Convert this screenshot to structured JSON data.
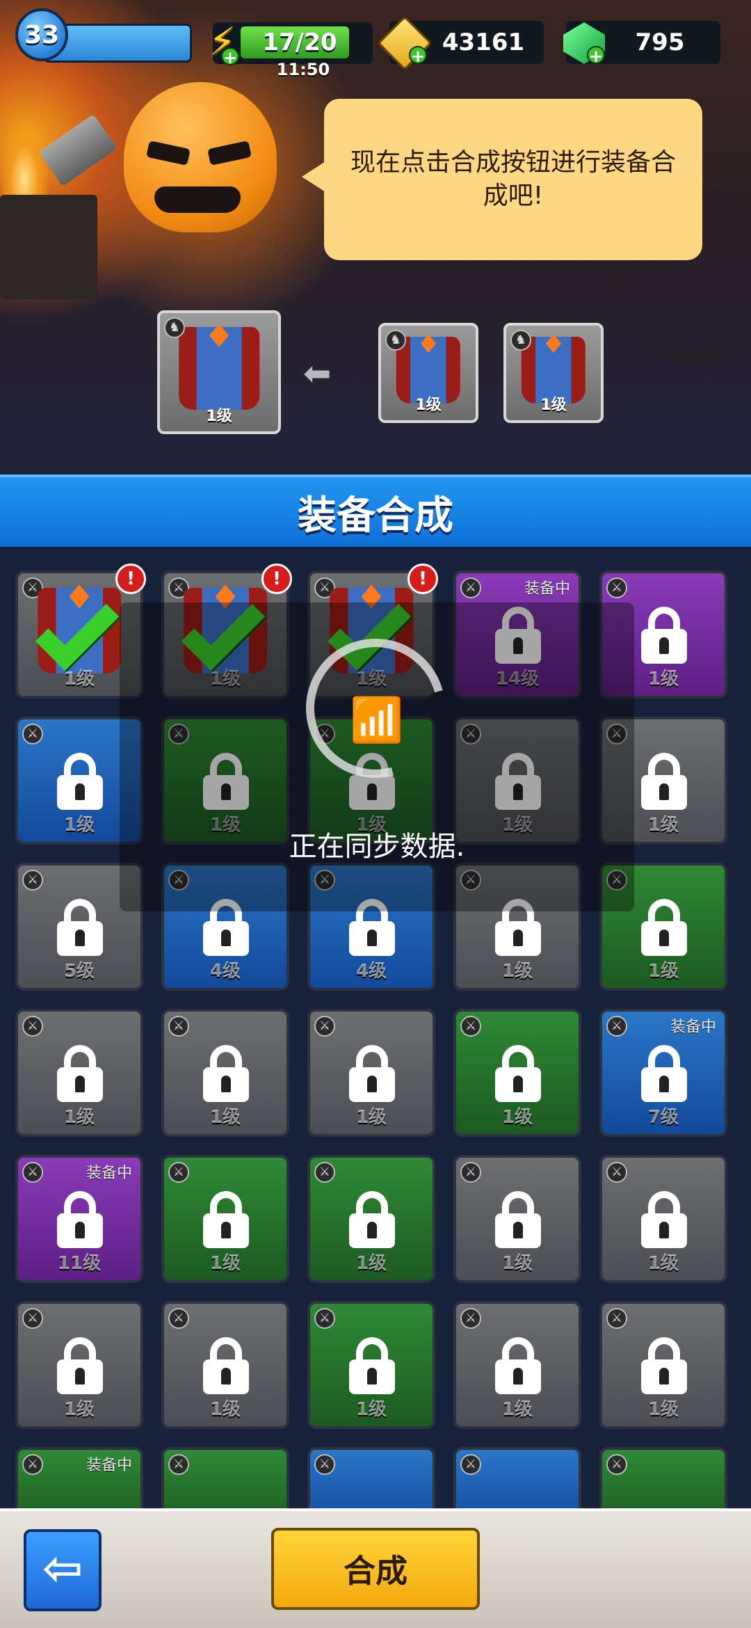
{
  "hud": {
    "player_level": "33",
    "energy": "17/20",
    "energy_timer": "11:50",
    "gold": "43161",
    "gems": "795"
  },
  "npc": {
    "speech": "现在点击合成按钮进行装备合成吧!"
  },
  "recipe": {
    "result": {
      "label": "1级"
    },
    "ingredients": [
      {
        "label": "1级"
      },
      {
        "label": "1级"
      }
    ]
  },
  "title": "装备合成",
  "sync_overlay": {
    "text": "正在同步数据."
  },
  "equip_tag": "装备中",
  "grid": [
    [
      {
        "tier": "gray",
        "label": "1级",
        "check": true,
        "alert": true
      },
      {
        "tier": "gray",
        "label": "1级",
        "check": true,
        "alert": true
      },
      {
        "tier": "gray",
        "label": "1级",
        "check": true,
        "alert": true
      },
      {
        "tier": "purple",
        "label": "14级",
        "equip": true
      },
      {
        "tier": "purple",
        "label": "1级"
      }
    ],
    [
      {
        "tier": "blue",
        "label": "1级"
      },
      {
        "tier": "green",
        "label": "1级"
      },
      {
        "tier": "green",
        "label": "1级"
      },
      {
        "tier": "gray",
        "label": "1级"
      },
      {
        "tier": "gray",
        "label": "1级"
      }
    ],
    [
      {
        "tier": "gray",
        "label": "5级"
      },
      {
        "tier": "blue",
        "label": "4级"
      },
      {
        "tier": "blue",
        "label": "4级"
      },
      {
        "tier": "gray",
        "label": "1级"
      },
      {
        "tier": "green",
        "label": "1级"
      }
    ],
    [
      {
        "tier": "gray",
        "label": "1级"
      },
      {
        "tier": "gray",
        "label": "1级"
      },
      {
        "tier": "gray",
        "label": "1级"
      },
      {
        "tier": "green",
        "label": "1级"
      },
      {
        "tier": "blue",
        "label": "7级",
        "equip": true
      }
    ],
    [
      {
        "tier": "purple",
        "label": "11级",
        "equip": true
      },
      {
        "tier": "green",
        "label": "1级"
      },
      {
        "tier": "green",
        "label": "1级"
      },
      {
        "tier": "gray",
        "label": "1级"
      },
      {
        "tier": "gray",
        "label": "1级"
      }
    ],
    [
      {
        "tier": "gray",
        "label": "1级"
      },
      {
        "tier": "gray",
        "label": "1级"
      },
      {
        "tier": "green",
        "label": "1级"
      },
      {
        "tier": "gray",
        "label": "1级"
      },
      {
        "tier": "gray",
        "label": "1级"
      }
    ],
    [
      {
        "tier": "green",
        "label": "",
        "equip": true
      },
      {
        "tier": "green",
        "label": ""
      },
      {
        "tier": "blue",
        "label": ""
      },
      {
        "tier": "blue",
        "label": ""
      },
      {
        "tier": "green",
        "label": ""
      }
    ]
  ],
  "buttons": {
    "back": "⇦",
    "merge": "合成"
  },
  "colors": {
    "band": "#1a86ea",
    "merge_button": "#f7b51d",
    "bubble": "#ffd783"
  }
}
